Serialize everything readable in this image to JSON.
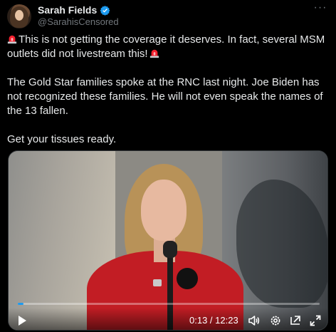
{
  "author": {
    "display_name": "Sarah Fields",
    "handle": "@SarahisCensored",
    "verified": true
  },
  "post": {
    "paragraphs": [
      "This is not getting the coverage it deserves. In fact, several MSM outlets did not livestream this!",
      "The Gold Star families spoke at the RNC last night. Joe Biden has not recognized these families. He will not even speak the names of the 13 fallen.",
      "Get your tissues ready."
    ]
  },
  "video": {
    "time_display": "0:13 / 12:23",
    "progress_fraction": 0.018
  },
  "colors": {
    "accent": "#1d9bf0",
    "siren": "#f4212e"
  },
  "icons": [
    "verified-badge-icon",
    "more-icon",
    "siren-icon",
    "play-icon",
    "volume-icon",
    "settings-icon",
    "picture-in-picture-icon",
    "fullscreen-icon"
  ]
}
